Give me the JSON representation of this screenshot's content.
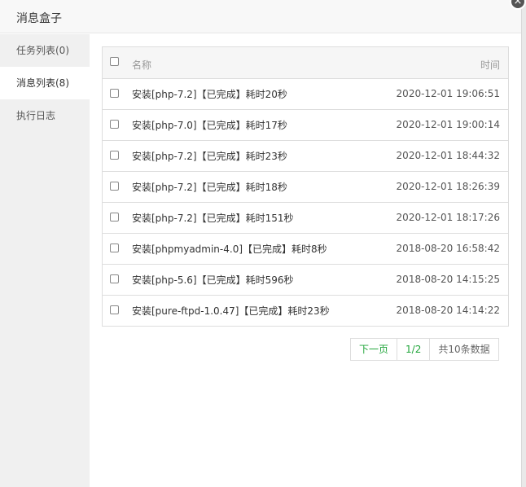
{
  "dialog": {
    "title": "消息盒子",
    "close_label": "×"
  },
  "sidebar": {
    "items": [
      {
        "label": "任务列表(0)"
      },
      {
        "label": "消息列表(8)"
      },
      {
        "label": "执行日志"
      }
    ]
  },
  "table": {
    "header": {
      "name": "名称",
      "time": "时间"
    },
    "rows": [
      {
        "name": "安装[php-7.2]【已完成】耗时20秒",
        "time": "2020-12-01 19:06:51"
      },
      {
        "name": "安装[php-7.0]【已完成】耗时17秒",
        "time": "2020-12-01 19:00:14"
      },
      {
        "name": "安装[php-7.2]【已完成】耗时23秒",
        "time": "2020-12-01 18:44:32"
      },
      {
        "name": "安装[php-7.2]【已完成】耗时18秒",
        "time": "2020-12-01 18:26:39"
      },
      {
        "name": "安装[php-7.2]【已完成】耗时151秒",
        "time": "2020-12-01 18:17:26"
      },
      {
        "name": "安装[phpmyadmin-4.0]【已完成】耗时8秒",
        "time": "2018-08-20 16:58:42"
      },
      {
        "name": "安装[php-5.6]【已完成】耗时596秒",
        "time": "2018-08-20 14:15:25"
      },
      {
        "name": "安装[pure-ftpd-1.0.47]【已完成】耗时23秒",
        "time": "2018-08-20 14:14:22"
      }
    ]
  },
  "pager": {
    "next_label": "下一页",
    "page": "1/2",
    "total": "共10条数据"
  },
  "colors": {
    "accent": "#20a53a"
  }
}
